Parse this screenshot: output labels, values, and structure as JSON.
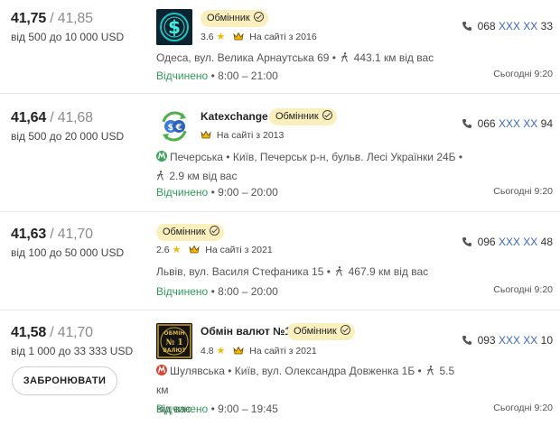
{
  "offers": [
    {
      "buy": "41,75",
      "sell": "/ 41,85",
      "range": "від 500 до 10 000 USD",
      "logo": "dollar-logo",
      "name": "",
      "badge": "Обмінник",
      "rating": "3.6",
      "since": "На сайті з 2016",
      "metro": "",
      "address": "Одеса, вул. Велика Арнаутська 69 •",
      "distance": "443.1 км від вас",
      "status": "Відчинено",
      "hours": "• 8:00 – 21:00",
      "phone_prefix": "068",
      "phone_hidden": "XXX XX",
      "phone_suffix": "33",
      "updated": "Сьогодні 9:20"
    },
    {
      "buy": "41,64",
      "sell": "/ 41,68",
      "range": "від 500 до 20 000 USD",
      "logo": "exchange-arrows-logo",
      "name": "Katexchange",
      "badge": "Обмінник",
      "rating": "",
      "since": "На сайті з 2013",
      "metro": "Печерська",
      "address": "• Київ, Печерськ р-н, бульв. Лесі Українки 24Б •",
      "distance": "2.9 км від вас",
      "status": "Відчинено",
      "hours": "• 9:00 – 20:00",
      "phone_prefix": "066",
      "phone_hidden": "XXX XX",
      "phone_suffix": "94",
      "updated": "Сьогодні 9:20"
    },
    {
      "buy": "41,63",
      "sell": "/ 41,70",
      "range": "від 100 до 50 000 USD",
      "logo": "",
      "name": "",
      "badge": "Обмінник",
      "rating": "2.6",
      "since": "На сайті з 2021",
      "metro": "",
      "address": "Львів, вул. Василя Стефаника 15 •",
      "distance": "467.9 км від вас",
      "status": "Відчинено",
      "hours": "• 8:00 – 20:00",
      "phone_prefix": "096",
      "phone_hidden": "XXX XX",
      "phone_suffix": "48",
      "updated": "Сьогодні 9:20"
    },
    {
      "buy": "41,58",
      "sell": "/ 41,70",
      "range": "від 1 000 до 33 333 USD",
      "logo": "obmin-valyut-logo",
      "logo_text_top": "ОБМІН",
      "logo_text_mid": "№ 1",
      "logo_text_bottom": "ВАЛЮТ",
      "name": "Обмін валют №1",
      "badge": "Обмінник",
      "rating": "4.8",
      "since": "На сайті з 2021",
      "metro": "Шулявська",
      "address": "• Київ, вул. Олександра Довженка 1Б •",
      "distance": "5.5 км",
      "distance_tail": "від вас",
      "status": "Відчинено",
      "hours": "• 9:00 – 19:45",
      "phone_prefix": "093",
      "phone_hidden": "XXX XX",
      "phone_suffix": "10",
      "updated": "Сьогодні 9:20",
      "book_label": "ЗАБРОНЮВАТИ"
    }
  ],
  "colors": {
    "badge_bg": "#fbefbd",
    "open_green": "#2e9b5b",
    "phone_blue": "#3a66c4",
    "metro_green": "#3aa55a",
    "metro_red": "#d9432f",
    "star": "#f5b800"
  }
}
